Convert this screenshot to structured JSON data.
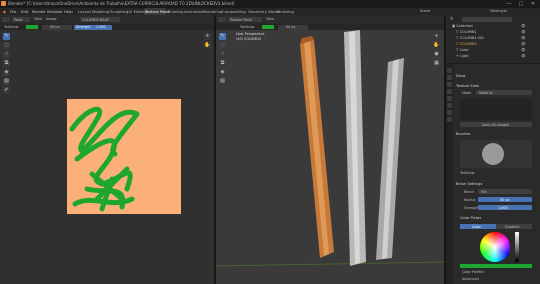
{
  "window": {
    "title": "Blender* [C:\\Users\\Itraco\\OneDrive\\Ambiente de Trabalho\\EXTRA CURRICULAR\\ROAD TO 2D\\UNLOCKEDV3.blend]",
    "minimize": "—",
    "maximize": "□",
    "close": "✕"
  },
  "menu": [
    "File",
    "Edit",
    "Render",
    "Window",
    "Help"
  ],
  "workspaces": [
    "Layout",
    "Modeling",
    "Sculpting",
    "UV Editing",
    "Texture Paint",
    "Shading",
    "Animation",
    "Rendering",
    "Compositing",
    "Geometry Nodes",
    "Scripting"
  ],
  "active_workspace": "Texture Paint",
  "scene": {
    "name": "Scene",
    "view_layer": "ViewLayer"
  },
  "image_editor": {
    "mode": "Paint",
    "image_name": "COLUMN3 BASE",
    "brush": "TexDraw",
    "strength_label": "Strength",
    "strength_value": "1.000",
    "radius_value": "50 px"
  },
  "viewport": {
    "mode": "Texture Paint",
    "overlay_line1": "User Perspective",
    "overlay_line2": "(40) COLUMN3"
  },
  "outliner": {
    "items": [
      "Collection",
      "COLUMN1",
      "COLUMN1.001",
      "COLUMN3",
      "Cube",
      "Light"
    ]
  },
  "properties": {
    "active_tool_title": "Draw",
    "texture_slots_title": "Texture Slots",
    "mode_label": "Mode",
    "mode_value": "Material",
    "save_button": "Save All Images",
    "brushes_title": "Brushes",
    "brush_name": "TexDraw",
    "brush_settings_title": "Brush Settings",
    "blend_label": "Blend",
    "blend_value": "Mix",
    "radius_label": "Radius",
    "radius_value": "50 px",
    "strength_label": "Strength",
    "strength_value": "1.000",
    "color_picker_title": "Color Picker",
    "gradient_tabs": [
      "Color",
      "Gradient"
    ],
    "color_palette_title": "Color Palette",
    "advanced_title": "Advanced"
  },
  "colors": {
    "texture_background": "#fbb07a",
    "paint_stroke": "#1fa62e",
    "active_color": "#1fa62e",
    "column_wood": "#c87a3a",
    "column_grey": "#b9b9b9",
    "accent_blue": "#4772b3"
  }
}
